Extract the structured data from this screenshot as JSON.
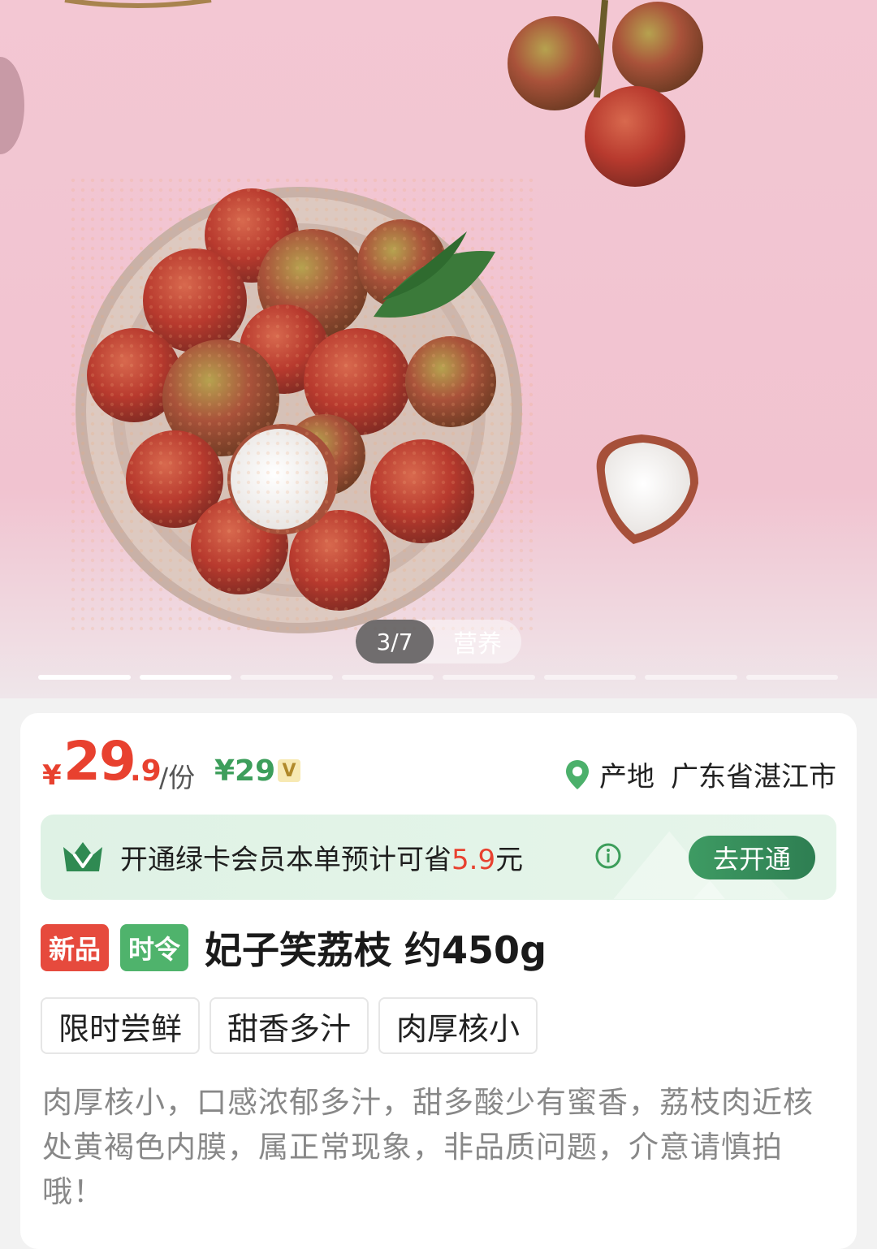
{
  "gallery": {
    "counter": "3/7",
    "label": "营养",
    "pages": 8,
    "active_pages": [
      0,
      1
    ]
  },
  "price": {
    "currency": "¥",
    "integer": "29",
    "decimal": ".9",
    "unit": "/份",
    "member_price": "¥29",
    "member_badge": "V"
  },
  "origin": {
    "label": "产地",
    "value": "广东省湛江市",
    "icon": "location-pin-icon"
  },
  "membership": {
    "text_before": "开通绿卡会员本单预计可省",
    "amount": "5.9",
    "text_after": "元",
    "button": "去开通",
    "icon": "crown-icon"
  },
  "product": {
    "tags": [
      "新品",
      "时令"
    ],
    "title": "妃子笑荔枝 约450g",
    "features": [
      "限时尝鲜",
      "甜香多汁",
      "肉厚核小"
    ],
    "description": "肉厚核小，口感浓郁多汁，甜多酸少有蜜香，荔枝肉近核处黄褐色内膜，属正常现象，非品质问题，介意请慎拍哦！"
  },
  "colors": {
    "price_red": "#e8412f",
    "brand_green": "#3d9e5b",
    "background_pink": "#f3c7d3"
  }
}
